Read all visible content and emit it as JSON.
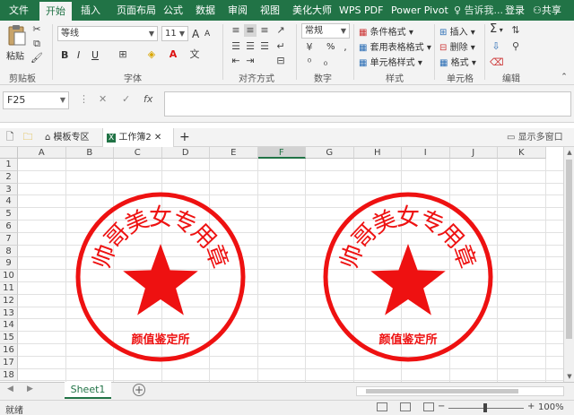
{
  "ribbon_tabs": [
    "文件",
    "开始",
    "插入",
    "页面布局",
    "公式",
    "数据",
    "审阅",
    "视图",
    "美化大师",
    "WPS PDF",
    "Power Pivot"
  ],
  "active_tab": "开始",
  "tell_me": "告诉我...",
  "login": "登录",
  "share": "共享",
  "clipboard": {
    "paste": "粘贴",
    "group": "剪贴板"
  },
  "font": {
    "name": "等线",
    "size": "11",
    "group": "字体",
    "bold": "B",
    "italic": "I",
    "underline": "U",
    "grow": "A",
    "shrink": "A"
  },
  "alignment": {
    "group": "对齐方式"
  },
  "number": {
    "format": "常规",
    "group": "数字",
    "percent": "%"
  },
  "styles": {
    "conditional": "条件格式",
    "table": "套用表格格式",
    "cell": "单元格样式",
    "group": "样式"
  },
  "cells": {
    "insert": "插入",
    "delete": "删除",
    "format": "格式",
    "group": "单元格"
  },
  "editing": {
    "group": "编辑",
    "sum": "Σ"
  },
  "formula_bar": {
    "name_box": "F25",
    "fx": "fx",
    "value": ""
  },
  "doc_tabs": {
    "template_zone": "模板专区",
    "workbook": "工作簿2",
    "add": "+",
    "show_multi": "显示多窗口"
  },
  "columns": [
    "A",
    "B",
    "C",
    "D",
    "E",
    "F",
    "G",
    "H",
    "I",
    "J",
    "K"
  ],
  "selected_column": "F",
  "rows": [
    "1",
    "2",
    "3",
    "4",
    "5",
    "6",
    "7",
    "8",
    "9",
    "10",
    "11",
    "12",
    "13",
    "14",
    "15",
    "16",
    "17",
    "18"
  ],
  "stamps": [
    {
      "arc_text": "帅哥美女专用章",
      "bottom_text": "颜值鉴定所"
    },
    {
      "arc_text": "帅哥美女专用章",
      "bottom_text": "颜值鉴定所"
    }
  ],
  "stamp_color": "#ee1111",
  "brand_color": "#217346",
  "sheet_tab": "Sheet1",
  "status": {
    "ready": "就绪",
    "zoom": "100%"
  }
}
